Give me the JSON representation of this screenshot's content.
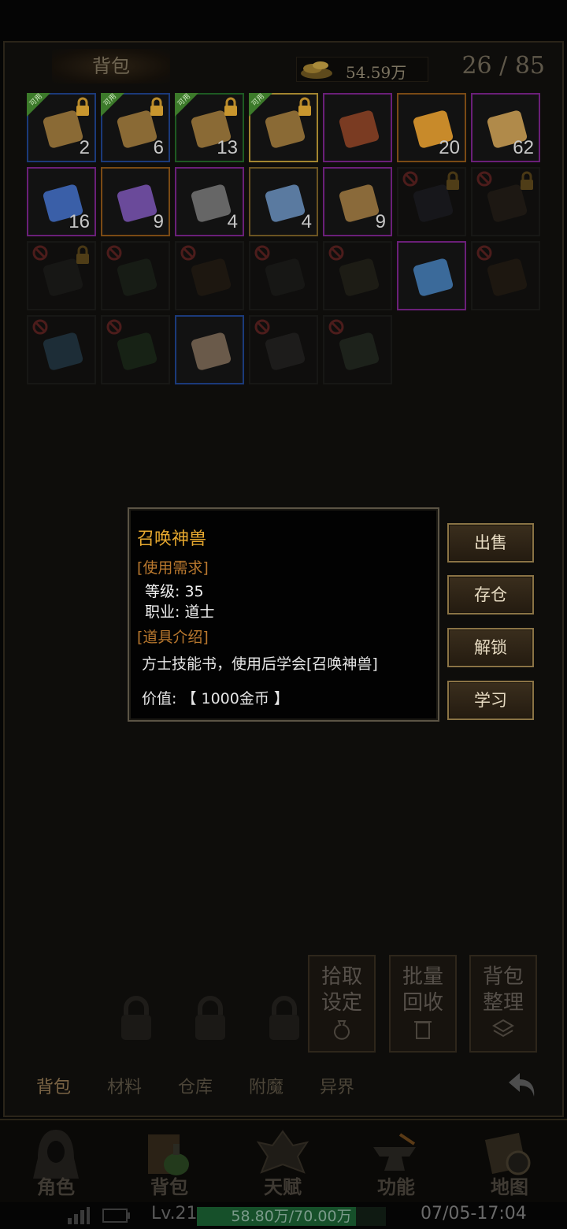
{
  "header": {
    "tab_title": "背包",
    "gold": "54.59万",
    "capacity": "26 / 85"
  },
  "slots": [
    {
      "count": "2",
      "tag": "可用",
      "locked": true
    },
    {
      "count": "6",
      "tag": "可用",
      "locked": true
    },
    {
      "count": "13",
      "tag": "可用",
      "locked": true
    },
    {
      "count": "",
      "tag": "可用",
      "locked": true,
      "selected": true
    },
    {
      "count": ""
    },
    {
      "count": "20"
    },
    {
      "count": "62"
    },
    {
      "count": "16"
    },
    {
      "count": "9"
    },
    {
      "count": "4"
    },
    {
      "count": "4"
    },
    {
      "count": "9"
    },
    {
      "count": "",
      "banned": true,
      "locked": true
    },
    {
      "count": "",
      "banned": true,
      "locked": true
    },
    {
      "count": "",
      "banned": true,
      "locked": true
    },
    {
      "count": "",
      "banned": true
    },
    {
      "count": "",
      "banned": true
    },
    {
      "count": "",
      "banned": true
    },
    {
      "count": "",
      "banned": true
    },
    {
      "count": ""
    },
    {
      "count": "",
      "banned": true
    },
    {
      "count": "",
      "banned": true
    },
    {
      "count": "",
      "banned": true
    },
    {
      "count": ""
    },
    {
      "count": "",
      "banned": true
    },
    {
      "count": "",
      "banned": true
    }
  ],
  "tooltip": {
    "name": "召唤神兽",
    "req_header": "[使用需求]",
    "level": "等级: 35",
    "job": "职业: 道士",
    "intro_header": "[道具介绍]",
    "desc": "方士技能书，使用后学会[召唤神兽]",
    "value": "价值: 【 1000金币 】"
  },
  "actions": {
    "sell": "出售",
    "store": "存仓",
    "unlock": "解锁",
    "learn": "学习"
  },
  "tools": {
    "pickup": "拾取设定",
    "recycle": "批量回收",
    "sort": "背包整理"
  },
  "subtabs": [
    "背包",
    "材料",
    "仓库",
    "附魔",
    "异界"
  ],
  "nav": [
    "角色",
    "背包",
    "天赋",
    "功能",
    "地图"
  ],
  "status": {
    "level": "Lv.21",
    "exp": "58.80万/70.00万",
    "exp_ratio": 0.84,
    "time": "07/05-17:04"
  },
  "colors": {
    "gold_text": "#e8a92f",
    "section_text": "#b9782e",
    "button_border": "#8a7345"
  }
}
